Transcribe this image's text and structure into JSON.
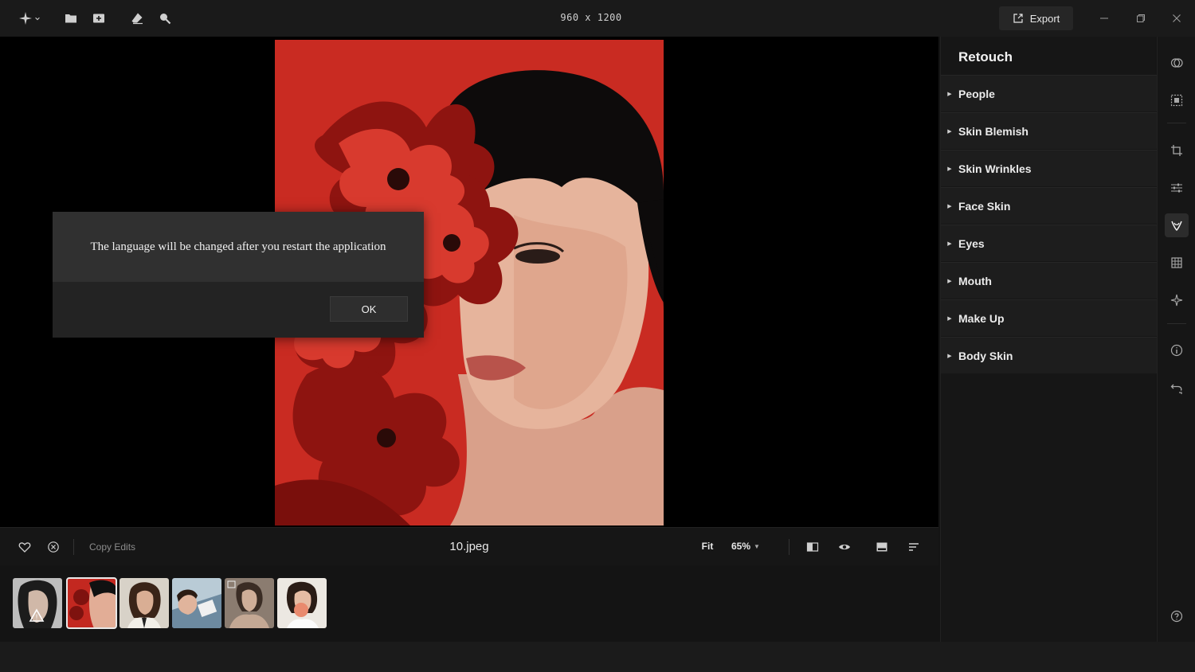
{
  "topbar": {
    "logo_icon": "sparkle-icon",
    "icons": [
      "folder-icon",
      "import-icon",
      "eraser-icon",
      "search-icon"
    ],
    "image_dimensions": "960 x 1200",
    "export_label": "Export",
    "window_controls": [
      "minimize-icon",
      "restore-icon",
      "close-icon"
    ]
  },
  "dialog": {
    "message": "The language will be changed after you restart the application",
    "ok_label": "OK"
  },
  "bottombar": {
    "copy_edits_label": "Copy Edits",
    "filename": "10.jpeg",
    "fit_label": "Fit",
    "zoom_label": "65%"
  },
  "filmstrip": {
    "thumbnail_count": 6,
    "selected_index": 1
  },
  "retouch": {
    "title": "Retouch",
    "items": [
      {
        "label": "People"
      },
      {
        "label": "Skin Blemish"
      },
      {
        "label": "Skin Wrinkles"
      },
      {
        "label": "Face Skin"
      },
      {
        "label": "Eyes"
      },
      {
        "label": "Mouth"
      },
      {
        "label": "Make Up"
      },
      {
        "label": "Body Skin"
      }
    ]
  },
  "rail": {
    "icons": [
      "presets-icon",
      "select-icon",
      "crop-icon",
      "adjust-icon",
      "retouch-icon",
      "grid-icon",
      "magic-icon",
      "info-icon",
      "history-icon",
      "help-icon"
    ],
    "active": "retouch-icon"
  },
  "colors": {
    "background": "#141414",
    "canvas": "#000000",
    "photo_red": "#c52a22",
    "panel": "#1d1d1d"
  }
}
